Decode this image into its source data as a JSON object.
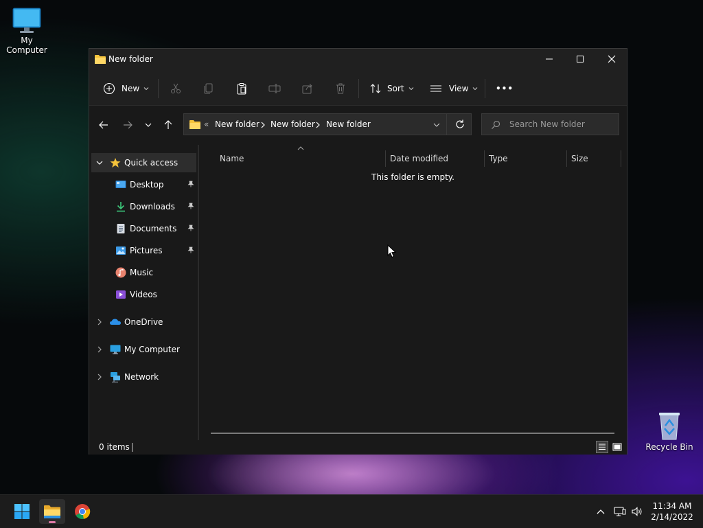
{
  "desktop": {
    "my_computer": "My Computer",
    "recycle_bin": "Recycle Bin"
  },
  "window": {
    "title": "New folder",
    "toolbar": {
      "new_label": "New",
      "sort_label": "Sort",
      "view_label": "View",
      "more_label": "•••"
    },
    "address": {
      "overflow": "«",
      "crumbs": [
        "New folder",
        "New folder",
        "New folder"
      ]
    },
    "search_placeholder": "Search New folder",
    "sidebar": {
      "quick_access": "Quick access",
      "items": [
        {
          "label": "Desktop",
          "pinned": true
        },
        {
          "label": "Downloads",
          "pinned": true
        },
        {
          "label": "Documents",
          "pinned": true
        },
        {
          "label": "Pictures",
          "pinned": true
        },
        {
          "label": "Music",
          "pinned": false
        },
        {
          "label": "Videos",
          "pinned": false
        }
      ],
      "onedrive": "OneDrive",
      "my_computer": "My Computer",
      "network": "Network"
    },
    "columns": {
      "name": "Name",
      "date_modified": "Date modified",
      "type": "Type",
      "size": "Size"
    },
    "empty_message": "This folder is empty.",
    "status": {
      "item_count": "0 items"
    }
  },
  "taskbar": {
    "time": "11:34 AM",
    "date": "2/14/2022"
  },
  "colors": {
    "window_bg": "#191919",
    "titlebar_bg": "#202020",
    "folder_yellow": "#f5c33b",
    "accent_blue": "#4cc2ff"
  }
}
